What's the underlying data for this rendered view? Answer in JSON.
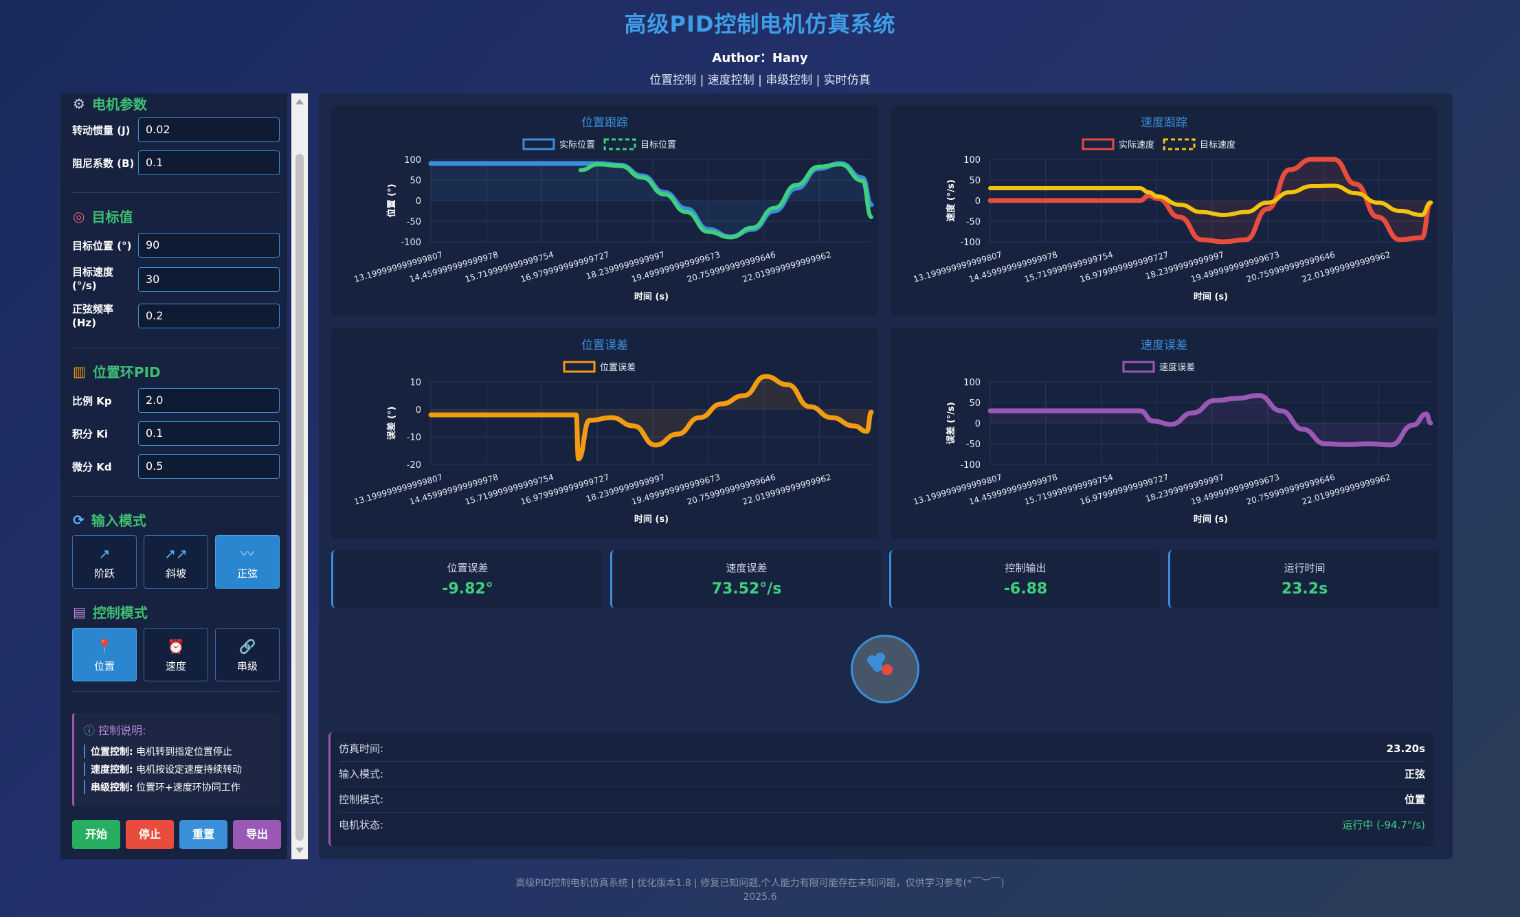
{
  "header": {
    "title": "高级PID控制电机仿真系统",
    "author": "Author：Hany",
    "subtitle": "位置控制 | 速度控制 | 串级控制 | 实时仿真"
  },
  "sidebar": {
    "motor_params": {
      "title": "电机参数",
      "icon": "gear-icon",
      "inertia_label": "转动惯量 (J)",
      "inertia_value": "0.02",
      "damping_label": "阻尼系数 (B)",
      "damping_value": "0.1"
    },
    "targets": {
      "title": "目标值",
      "icon": "target-icon",
      "position_label": "目标位置 (°)",
      "position_value": "90",
      "speed_label": "目标速度 (°/s)",
      "speed_value": "30",
      "freq_label": "正弦频率 (Hz)",
      "freq_value": "0.2"
    },
    "pid": {
      "title": "位置环PID",
      "icon": "chart-icon",
      "kp_label": "比例 Kp",
      "kp_value": "2.0",
      "ki_label": "积分 Ki",
      "ki_value": "0.1",
      "kd_label": "微分 Kd",
      "kd_value": "0.5"
    },
    "input_mode": {
      "title": "输入模式",
      "icon": "refresh-icon",
      "buttons": [
        {
          "label": "阶跃",
          "icon": "arrow-up-right-icon",
          "glyph": "↗"
        },
        {
          "label": "斜坡",
          "icon": "double-arrow-icon",
          "glyph": "↗↗"
        },
        {
          "label": "正弦",
          "icon": "wave-icon",
          "glyph": "〰"
        }
      ],
      "selected": "正弦"
    },
    "control_mode": {
      "title": "控制模式",
      "icon": "notebook-icon",
      "buttons": [
        {
          "label": "位置",
          "icon": "pin-icon",
          "glyph": "📍"
        },
        {
          "label": "速度",
          "icon": "alarm-clock-icon",
          "glyph": "⏰"
        },
        {
          "label": "串级",
          "icon": "link-icon",
          "glyph": "🔗"
        }
      ],
      "selected": "位置"
    },
    "note": {
      "title": "控制说明:",
      "items": [
        {
          "k": "位置控制:",
          "v": "电机转到指定位置停止"
        },
        {
          "k": "速度控制:",
          "v": "电机按设定速度持续转动"
        },
        {
          "k": "串级控制:",
          "v": "位置环+速度环协同工作"
        }
      ]
    },
    "actions": {
      "start": "开始",
      "stop": "停止",
      "reset": "重置",
      "export": "导出"
    }
  },
  "charts_common": {
    "xlabel": "时间 (s)",
    "x_ticks": [
      "13.199999999999807",
      "14.459999999999978",
      "15.719999999999754",
      "16.979999999999727",
      "18.2399999999997",
      "19.499999999999673",
      "20.759999999999646",
      "22.019999999999962"
    ]
  },
  "chart_data": [
    {
      "type": "line",
      "title": "位置跟踪",
      "ylabel": "位置 (°)",
      "ylim": [
        -100,
        100
      ],
      "y_ticks": [
        100,
        50,
        0,
        -50,
        -100
      ],
      "grid": true,
      "legend_position": "top",
      "x": [
        13.2,
        14,
        15,
        16,
        16.6,
        17,
        17.5,
        18,
        18.5,
        19,
        19.5,
        20,
        20.5,
        21,
        21.5,
        22,
        22.5,
        23,
        23.2
      ],
      "series": [
        {
          "name": "实际位置",
          "color": "#3a8fd8",
          "values": [
            90,
            90,
            90,
            90,
            90,
            90,
            86,
            60,
            20,
            -20,
            -70,
            -88,
            -70,
            -25,
            30,
            78,
            90,
            55,
            -10
          ]
        },
        {
          "name": "目标位置",
          "color": "#3fd07e",
          "dashed": true,
          "values": [
            null,
            null,
            null,
            null,
            74,
            88,
            84,
            56,
            15,
            -28,
            -76,
            -89,
            -66,
            -18,
            38,
            82,
            88,
            48,
            -40
          ]
        }
      ]
    },
    {
      "type": "line",
      "title": "速度跟踪",
      "ylabel": "速度 (°/s)",
      "ylim": [
        -100,
        100
      ],
      "y_ticks": [
        100,
        50,
        0,
        -50,
        -100
      ],
      "grid": true,
      "legend_position": "top",
      "x": [
        13.2,
        14,
        15,
        16,
        16.6,
        16.8,
        17,
        17.5,
        18,
        18.5,
        19,
        19.5,
        20,
        20.5,
        21,
        21.5,
        22,
        22.5,
        23,
        23.2
      ],
      "series": [
        {
          "name": "实际速度",
          "color": "#e74c3c",
          "values": [
            0,
            0,
            0,
            0,
            0,
            12,
            5,
            -40,
            -95,
            -100,
            -95,
            -20,
            75,
            100,
            100,
            40,
            -40,
            -95,
            -90,
            -5
          ]
        },
        {
          "name": "目标速度",
          "color": "#f1c40f",
          "dashed": true,
          "values": [
            30,
            30,
            30,
            30,
            30,
            20,
            10,
            -10,
            -28,
            -35,
            -28,
            -5,
            20,
            35,
            36,
            18,
            -5,
            -25,
            -35,
            -5
          ]
        }
      ]
    },
    {
      "type": "line",
      "title": "位置误差",
      "ylabel": "误差 (°)",
      "ylim": [
        -20,
        10
      ],
      "y_ticks": [
        10,
        0,
        -10,
        -20
      ],
      "grid": true,
      "legend_position": "top",
      "x": [
        13.2,
        14,
        15,
        16,
        16.5,
        16.55,
        16.8,
        17.3,
        17.8,
        18.3,
        18.8,
        19.3,
        19.8,
        20.3,
        20.8,
        21.3,
        21.8,
        22.3,
        22.8,
        23.1,
        23.2
      ],
      "series": [
        {
          "name": "位置误差",
          "color": "#f39c12",
          "values": [
            -2,
            -2,
            -2,
            -2,
            -2,
            -18,
            -4,
            -3,
            -6,
            -13,
            -9,
            -3,
            2,
            5,
            12,
            9,
            1,
            -3,
            -6,
            -8,
            -1
          ]
        }
      ]
    },
    {
      "type": "line",
      "title": "速度误差",
      "ylabel": "误差 (°/s)",
      "ylim": [
        -100,
        100
      ],
      "y_ticks": [
        100,
        50,
        0,
        -50,
        -100
      ],
      "grid": true,
      "legend_position": "top",
      "x": [
        13.2,
        14,
        15,
        16,
        16.6,
        16.9,
        17.3,
        17.8,
        18.3,
        18.8,
        19.3,
        19.8,
        20.3,
        20.8,
        21.3,
        21.8,
        22.3,
        22.8,
        23.1,
        23.2
      ],
      "series": [
        {
          "name": "速度误差",
          "color": "#9b59b6",
          "values": [
            30,
            30,
            30,
            30,
            30,
            5,
            -3,
            25,
            55,
            60,
            67,
            30,
            -15,
            -50,
            -52,
            -50,
            -53,
            -5,
            22,
            0
          ]
        }
      ]
    }
  ],
  "stats": [
    {
      "label": "位置误差",
      "value": "-9.82°"
    },
    {
      "label": "速度误差",
      "value": "73.52°/s"
    },
    {
      "label": "控制输出",
      "value": "-6.88"
    },
    {
      "label": "运行时间",
      "value": "23.2s"
    }
  ],
  "info": {
    "sim_time_label": "仿真时间:",
    "sim_time_value": "23.20s",
    "input_mode_label": "输入模式:",
    "input_mode_value": "正弦",
    "control_mode_label": "控制模式:",
    "control_mode_value": "位置",
    "motor_state_label": "电机状态:",
    "motor_state_value": "运行中 (-94.7°/s)"
  },
  "footer": {
    "line1": "高级PID控制电机仿真系统 | 优化版本1.8 | 修复已知问题,个人能力有限可能存在未知问题，仅供学习参考(*￣︶￣)",
    "line2": "2025.6"
  },
  "colors": {
    "accent": "#3a8fd8",
    "green": "#3fd07e",
    "red": "#e74c3c",
    "orange": "#f39c12",
    "purple": "#9b59b6",
    "yellow": "#f1c40f"
  }
}
